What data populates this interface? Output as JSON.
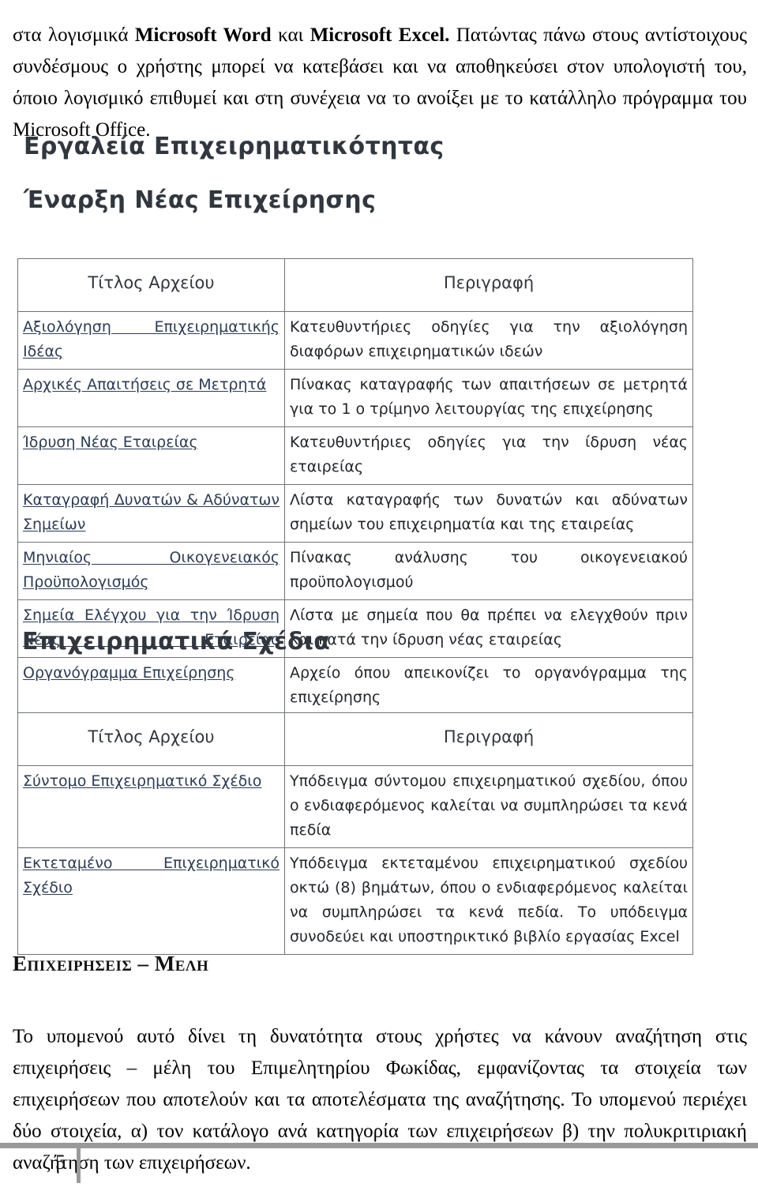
{
  "document": {
    "page_number": "5",
    "intro_paragraph_prefix": "στα λογισμικά ",
    "intro_paragraph": "στα λογισμικά Microsoft Word και Microsoft Excel. Πατώντας πάνω στους αντίστοιχους συνδέσμους ο χρήστης μπορεί να κατεβάσει και να αποθηκεύσει στον υπολογιστή του, όποιο λογισμικό επιθυμεί και στη συνέχεια να το ανοίξει με το κατάλληλο πρόγραμμα του Microsoft Office.",
    "intro_bold_1": "Microsoft Word",
    "intro_mid_1": " και ",
    "intro_bold_2": "Microsoft Excel.",
    "intro_rest": " Πατώντας πάνω στους αντίστοιχους συνδέσμους ο χρήστης μπορεί να κατεβάσει και να αποθηκεύσει στον υπολογιστή του, όποιο λογισμικό επιθυμεί και στη συνέχεια να το ανοίξει με το κατάλληλο πρόγραμμα του Microsoft Office.",
    "section_heading_members": "Επιχειρησεις – Μελη",
    "closing_paragraph": "Το υπομενού αυτό δίνει τη δυνατότητα στους χρήστες να κάνουν αναζήτηση στις επιχειρήσεις – μέλη του Επιμελητηρίου Φωκίδας, εμφανίζοντας τα στοιχεία των επιχειρήσεων που αποτελούν και τα αποτελέσματα της αναζήτησης. Το υπομενού περιέχει δύο στοιχεία, α) τον κατάλογο ανά κατηγορία των επιχειρήσεων β) την πολυκριτιριακή αναζήτηση των επιχειρήσεων."
  },
  "screenshot": {
    "heading_tools": "Εργαλεία Επιχειρηματικότητας",
    "heading_new_business": "Έναρξη Νέας Επιχείρησης",
    "heading_business_plans": "Επιχειρηματικά Σχέδια",
    "colors": {
      "heading": "#31373f",
      "link": "#2c3c55",
      "table_border": "#6f7479",
      "footer_rule": "#9a9a9a"
    },
    "table_headers": {
      "title": "Τίτλος Αρχείου",
      "description": "Περιγραφή"
    },
    "startup_table": [
      {
        "title": "Αξιολόγηση Επιχειρηματικής Ιδέας",
        "description": "Κατευθυντήριες οδηγίες για την αξιολόγηση διαφόρων επιχειρηματικών ιδεών"
      },
      {
        "title": "Αρχικές Απαιτήσεις σε Μετρητά",
        "description": "Πίνακας καταγραφής των απαιτήσεων σε μετρητά για το 1 ο τρίμηνο λειτουργίας της επιχείρησης"
      },
      {
        "title": "Ίδρυση Νέας Εταιρείας",
        "description": "Κατευθυντήριες οδηγίες για την ίδρυση νέας εταιρείας"
      },
      {
        "title": "Καταγραφή Δυνατών & Αδύνατων Σημείων",
        "description": "Λίστα καταγραφής των δυνατών και αδύνατων σημείων του επιχειρηματία και της εταιρείας"
      },
      {
        "title": "Μηνιαίος Οικογενειακός Προϋπολογισμός",
        "description": "Πίνακας ανάλυσης του οικογενειακού προϋπολογισμού"
      },
      {
        "title": "Σημεία Ελέγχου για την Ίδρυση Νέας Εταιρείας",
        "description": "Λίστα με σημεία που θα πρέπει να ελεγχθούν πριν και κατά την ίδρυση νέας εταιρείας"
      },
      {
        "title": "Οργανόγραμμα Επιχείρησης",
        "description": "Αρχείο όπου απεικονίζει το οργανόγραμμα της επιχείρησης"
      }
    ],
    "plans_table": [
      {
        "title": "Σύντομο Επιχειρηματικό Σχέδιο",
        "description": "Υπόδειγμα σύντομου επιχειρηματικού σχεδίου, όπου ο ενδιαφερόμενος καλείται να συμπληρώσει τα κενά πεδία"
      },
      {
        "title": "Εκτεταμένο Επιχειρηματικό Σχέδιο",
        "description": "Υπόδειγμα εκτεταμένου επιχειρηματικού σχεδίου οκτώ (8) βημάτων, όπου ο ενδιαφερόμενος καλείται να συμπληρώσει τα κενά πεδία. Το υπόδειγμα συνοδεύει και υποστηρικτικό βιβλίο εργασίας Excel"
      }
    ]
  }
}
